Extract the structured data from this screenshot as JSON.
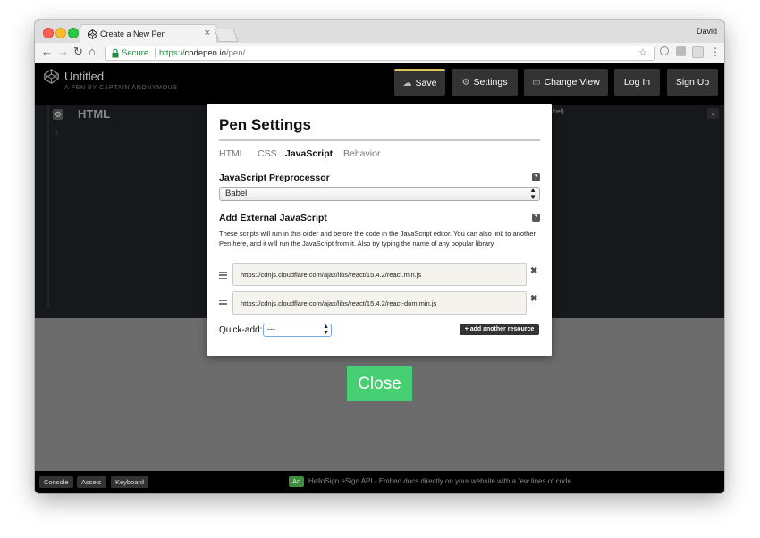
{
  "browser": {
    "tab_title": "Create a New Pen",
    "tab_close": "×",
    "profile": "David",
    "secure_label": "Secure",
    "url_scheme": "https://",
    "url_host": "codepen.io",
    "url_path": "/pen/",
    "nav": {
      "back": "←",
      "forward": "→",
      "reload": "↻",
      "home": "⌂"
    },
    "star": "☆",
    "menu": "⋮"
  },
  "codepen": {
    "title": "Untitled",
    "byline": "A PEN BY CAPTAIN ANONYMOUS",
    "buttons": {
      "save": "Save",
      "settings": "Settings",
      "change_view": "Change View",
      "login": "Log In",
      "signup": "Sign Up"
    },
    "icons": {
      "cloud": "☁",
      "gear": "⚙",
      "view": "▭"
    }
  },
  "editor": {
    "pane_title": "HTML",
    "line_number": "1",
    "babel_hint": "bel)",
    "collapse": "⌄",
    "gear": "⚙"
  },
  "modal": {
    "title": "Pen Settings",
    "tabs": [
      "HTML",
      "CSS",
      "JavaScript",
      "Behavior"
    ],
    "active_tab": "JavaScript",
    "preprocessor_label": "JavaScript Preprocessor",
    "preprocessor_value": "Babel",
    "external_label": "Add External JavaScript",
    "help": "?",
    "description": "These scripts will run in this order and before the code in the JavaScript editor. You can also link to another Pen here, and it will run the JavaScript from it. Also try typing the name of any popular library.",
    "resources": [
      "https://cdnjs.cloudflare.com/ajax/libs/react/15.4.2/react.min.js",
      "https://cdnjs.cloudflare.com/ajax/libs/react/15.4.2/react-dom.min.js"
    ],
    "remove": "✖",
    "quick_add_label": "Quick-add:",
    "quick_add_value": "---",
    "add_resource": "+ add another resource",
    "select_arrows": "▲▼"
  },
  "close_button": "Close",
  "footer": {
    "buttons": [
      "Console",
      "Assets",
      "Keyboard"
    ],
    "ad_badge": "Ad",
    "ad_text": "HelloSign eSign API - Embed docs directly on your website with a few lines of code"
  },
  "colors": {
    "close_green": "#47cf73",
    "save_accent": "#d9c45a",
    "secure_green": "#1e8e3e"
  }
}
